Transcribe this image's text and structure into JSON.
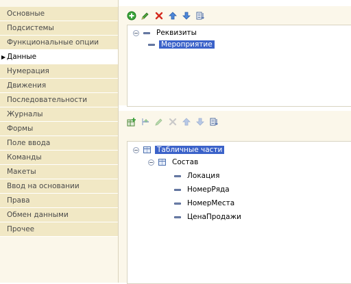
{
  "sidebar": {
    "items": [
      {
        "label": "Основные"
      },
      {
        "label": "Подсистемы"
      },
      {
        "label": "Функциональные опции"
      },
      {
        "label": "Данные",
        "active": true
      },
      {
        "label": "Нумерация"
      },
      {
        "label": "Движения"
      },
      {
        "label": "Последовательности"
      },
      {
        "label": "Журналы"
      },
      {
        "label": "Формы"
      },
      {
        "label": "Поле ввода"
      },
      {
        "label": "Команды"
      },
      {
        "label": "Макеты"
      },
      {
        "label": "Ввод на основании"
      },
      {
        "label": "Права"
      },
      {
        "label": "Обмен данными"
      },
      {
        "label": "Прочее"
      }
    ]
  },
  "attributes_panel": {
    "toolbar": [
      "add-icon",
      "edit-pencil-icon",
      "delete-cross-icon",
      "move-up-icon",
      "move-down-icon",
      "sort-list-icon"
    ],
    "tree": {
      "root": "Реквизиты",
      "children": [
        "Мероприятие"
      ]
    }
  },
  "tabular_panel": {
    "toolbar": [
      "add-table-icon",
      "add-column-icon",
      "edit-pencil-icon",
      "delete-cross-icon",
      "move-up-icon",
      "move-down-icon",
      "sort-list-icon"
    ],
    "tree": {
      "root": "Табличные части",
      "table": "Состав",
      "columns": [
        "Локация",
        "НомерРяда",
        "НомерМеста",
        "ЦенаПродажи"
      ]
    }
  },
  "colors": {
    "sidebar_item": "#f1e8c5",
    "panel_bg": "#fbf7ea",
    "selection": "#3b62c9"
  }
}
